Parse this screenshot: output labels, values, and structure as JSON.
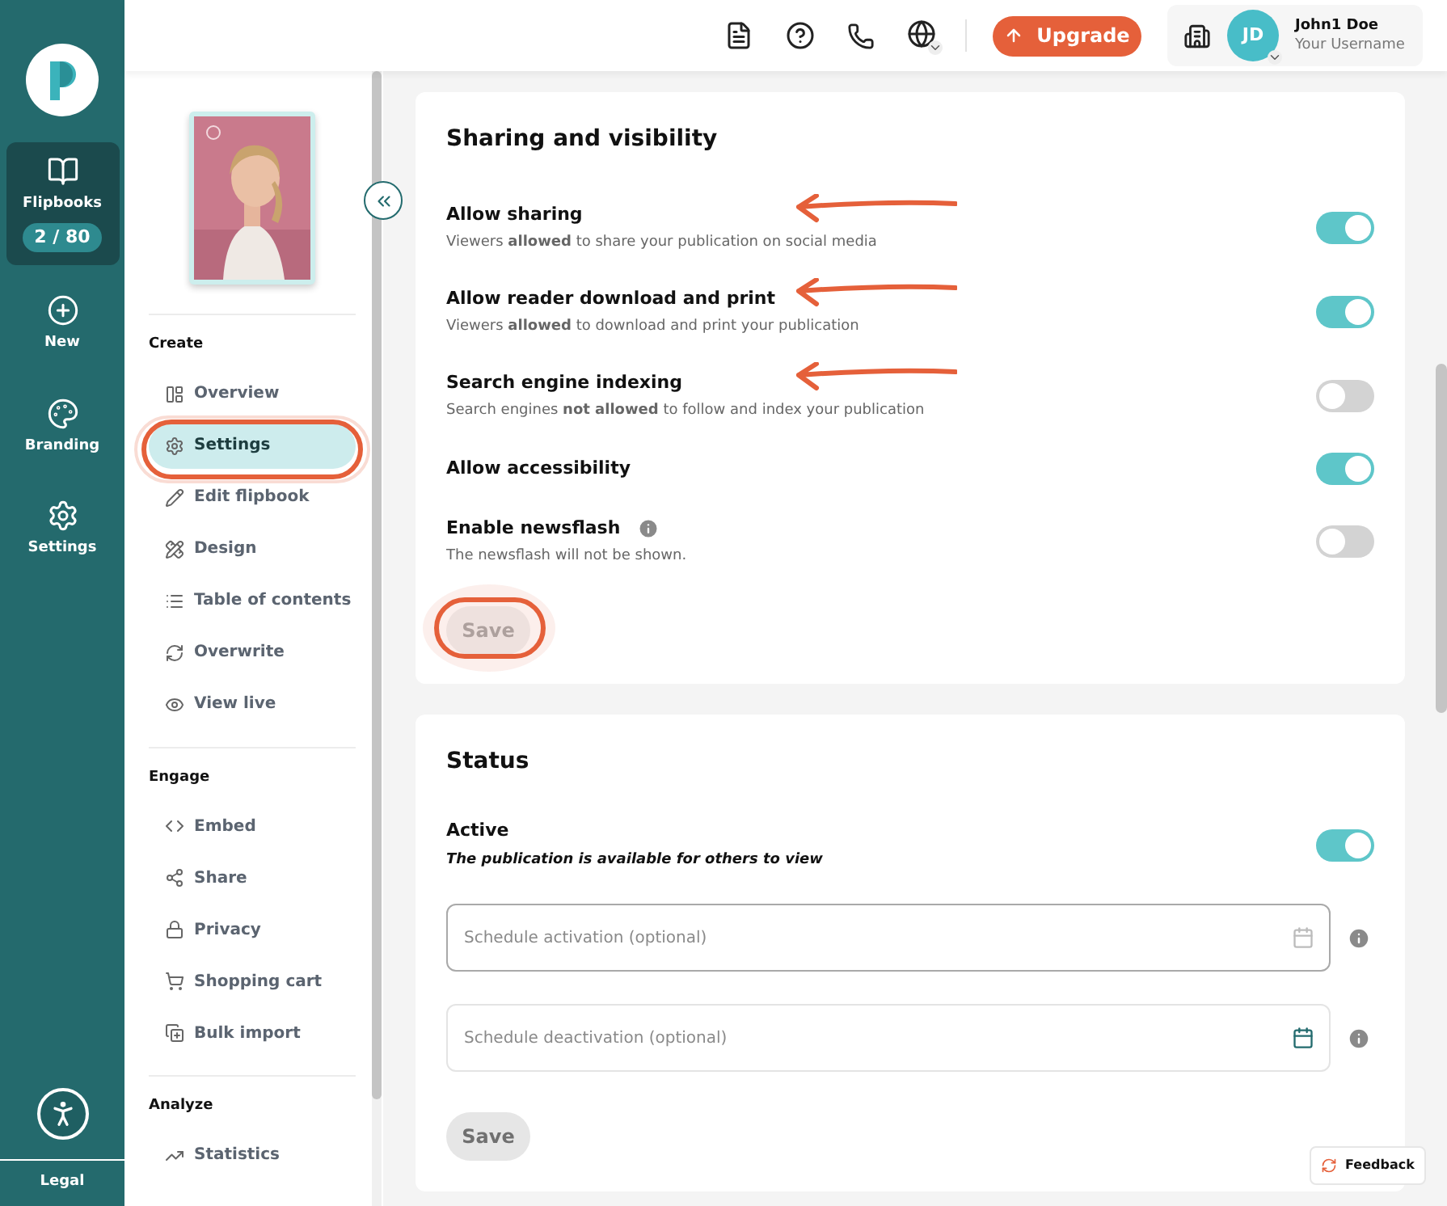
{
  "rail": {
    "items": [
      {
        "kind": "counter",
        "label": "Flipbooks",
        "count": "2 / 80",
        "selected": true
      },
      {
        "kind": "link",
        "label": "New",
        "selected": false
      },
      {
        "kind": "link",
        "label": "Branding",
        "selected": false
      },
      {
        "kind": "link",
        "label": "Settings",
        "selected": false
      }
    ],
    "footer": "Legal"
  },
  "topbar": {
    "upgrade": "Upgrade",
    "avatar": "JD",
    "user_name": "John1 Doe",
    "username": "Your Username"
  },
  "sidebar": {
    "sections": [
      {
        "title": "Create",
        "items": [
          {
            "label": "Overview",
            "selected": false
          },
          {
            "label": "Settings",
            "selected": true
          },
          {
            "label": "Edit flipbook",
            "selected": false
          },
          {
            "label": "Design",
            "selected": false
          },
          {
            "label": "Table of contents",
            "selected": false
          },
          {
            "label": "Overwrite",
            "selected": false
          },
          {
            "label": "View live",
            "selected": false
          }
        ]
      },
      {
        "title": "Engage",
        "items": [
          {
            "label": "Embed",
            "selected": false
          },
          {
            "label": "Share",
            "selected": false
          },
          {
            "label": "Privacy",
            "selected": false
          },
          {
            "label": "Shopping cart",
            "selected": false
          },
          {
            "label": "Bulk import",
            "selected": false
          }
        ]
      },
      {
        "title": "Analyze",
        "items": [
          {
            "label": "Statistics",
            "selected": false
          }
        ]
      }
    ]
  },
  "sharing": {
    "title": "Sharing and visibility",
    "settings": [
      {
        "label": "Allow sharing",
        "description": "Viewers **allowed** to share your publication on social media",
        "on": true,
        "info": false
      },
      {
        "label": "Allow reader download and print",
        "description": "Viewers **allowed** to download and print your publication",
        "on": true,
        "info": false
      },
      {
        "label": "Search engine indexing",
        "description": "Search engines **not allowed** to follow and index your publication",
        "on": false,
        "info": false
      },
      {
        "label": "Allow accessibility",
        "on": true,
        "info": false
      },
      {
        "label": "Enable newsflash",
        "description": "The newsflash will not be shown.",
        "on": false,
        "info": true
      }
    ],
    "save": {
      "label": "Save",
      "disabled": true
    }
  },
  "status": {
    "title": "Status",
    "active": {
      "label": "Active",
      "description": "The publication is available for others to view",
      "on": true
    },
    "fields": [
      {
        "placeholder": "Schedule activation (optional)",
        "focused": true
      },
      {
        "placeholder": "Schedule deactivation (optional)",
        "focused": false
      }
    ],
    "save": {
      "label": "Save",
      "disabled": true
    }
  },
  "feedback": "Feedback"
}
